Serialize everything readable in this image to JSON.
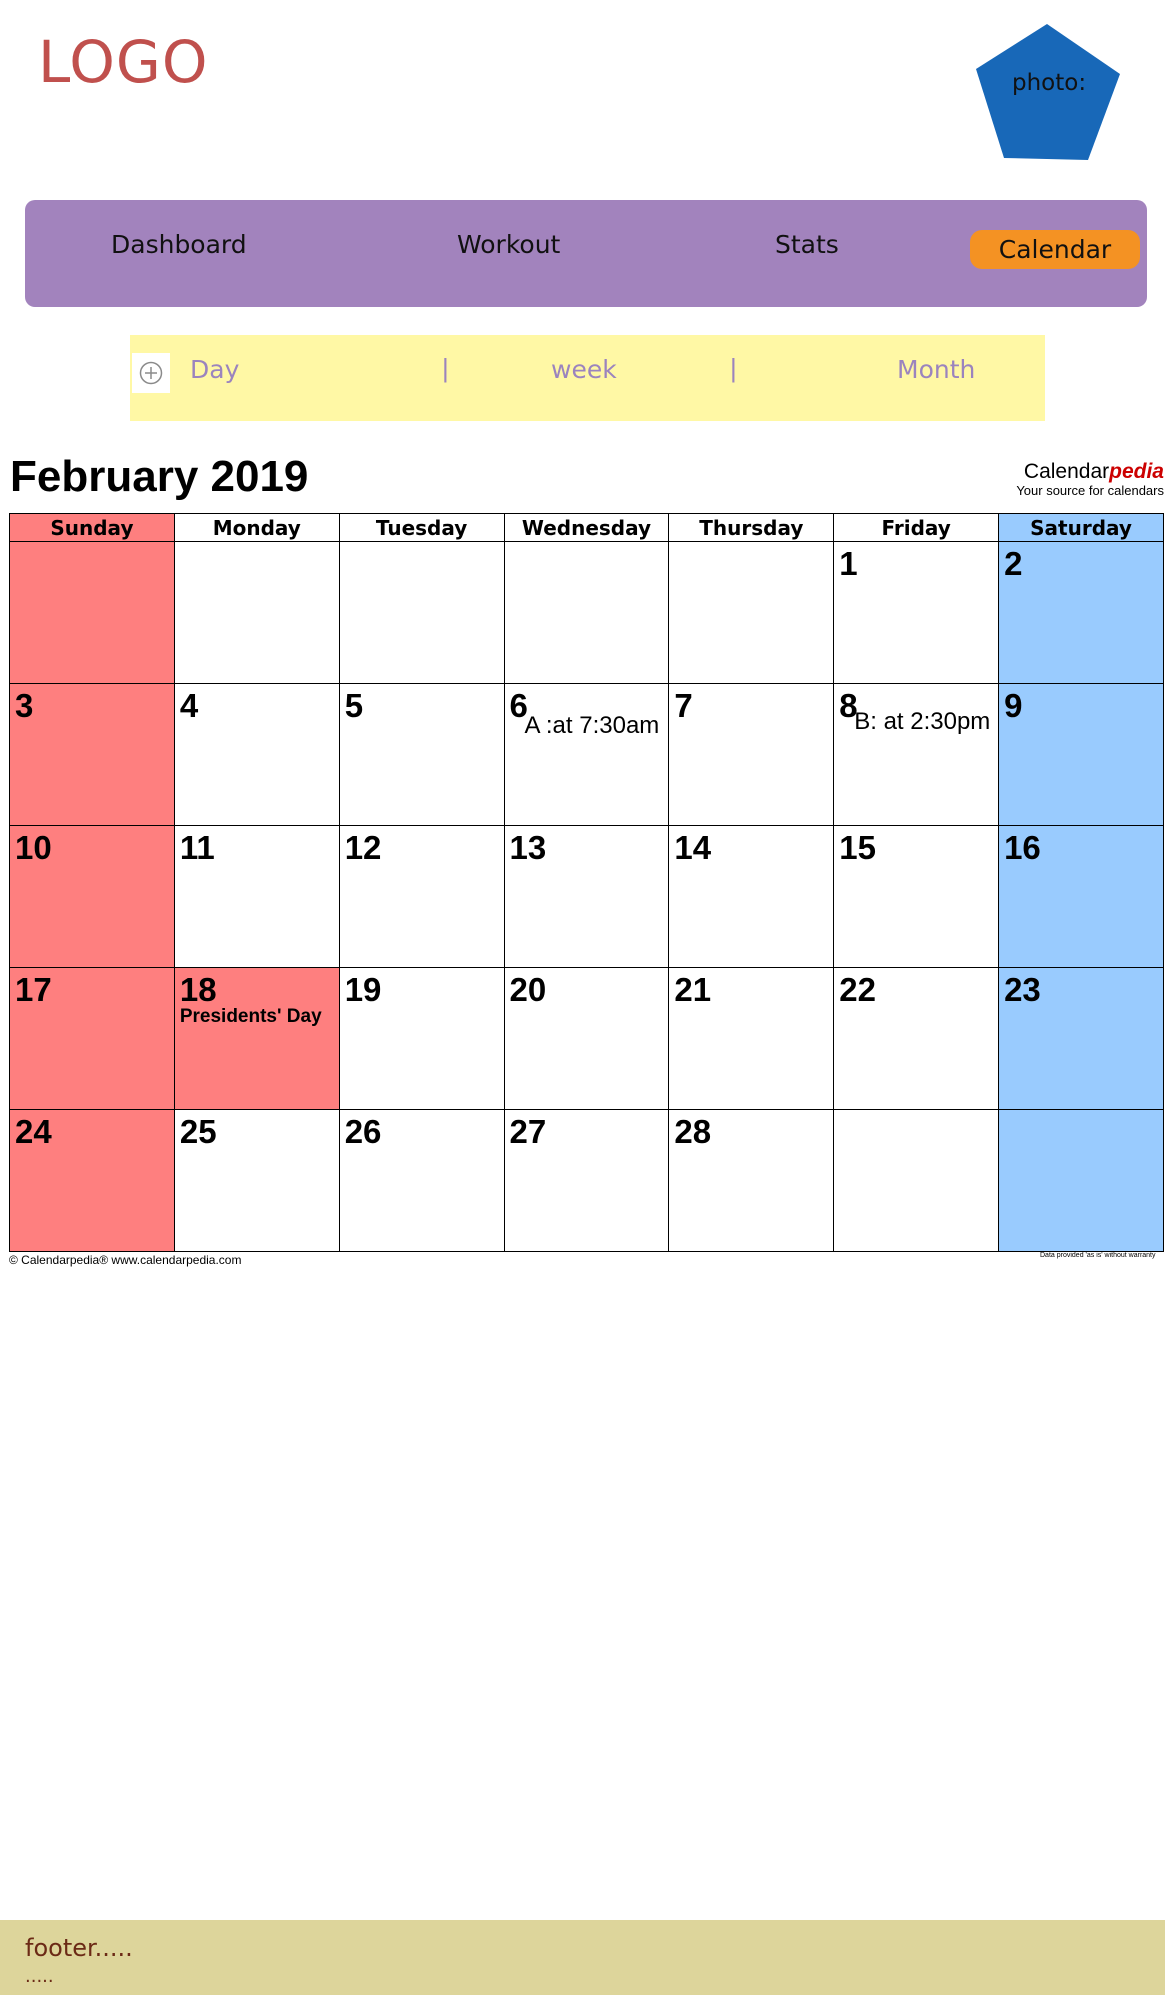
{
  "header": {
    "logo": "LOGO",
    "photo_label": "photo:",
    "photo_color": "#1868b8"
  },
  "nav": {
    "items": [
      "Dashboard",
      "Workout",
      "Stats",
      "Calendar"
    ],
    "active": "Calendar",
    "bg_color": "#a283bd",
    "active_color": "#f49223"
  },
  "view_bar": {
    "add_icon": "plus-circle-icon",
    "options": [
      "Day",
      "week",
      "Month"
    ],
    "separator": "|",
    "bg_color": "#fff8a5"
  },
  "calendar": {
    "month_title": "February 2019",
    "brand_name_plain": "Calendar",
    "brand_name_accent": "pedia",
    "brand_tagline": "Your source for calendars",
    "weekdays": [
      "Sunday",
      "Monday",
      "Tuesday",
      "Wednesday",
      "Thursday",
      "Friday",
      "Saturday"
    ],
    "weeks": [
      [
        "",
        "",
        "",
        "",
        "",
        "1",
        "2"
      ],
      [
        "3",
        "4",
        "5",
        "6",
        "7",
        "8",
        "9"
      ],
      [
        "10",
        "11",
        "12",
        "13",
        "14",
        "15",
        "16"
      ],
      [
        "17",
        "18",
        "19",
        "20",
        "21",
        "22",
        "23"
      ],
      [
        "24",
        "25",
        "26",
        "27",
        "28",
        "",
        ""
      ]
    ],
    "events": {
      "6": "A :at 7:30am",
      "8": "B: at 2:30pm"
    },
    "holidays": {
      "18": "Presidents' Day"
    },
    "footer_left": "© Calendarpedia®   www.calendarpedia.com",
    "footer_right": "Data provided 'as is' without warranty",
    "colors": {
      "sunday": "#fe7f7f",
      "saturday": "#99cbfe",
      "holiday": "#fe7f7f"
    }
  },
  "footer": {
    "line1": "footer.....",
    "line2": "....."
  }
}
